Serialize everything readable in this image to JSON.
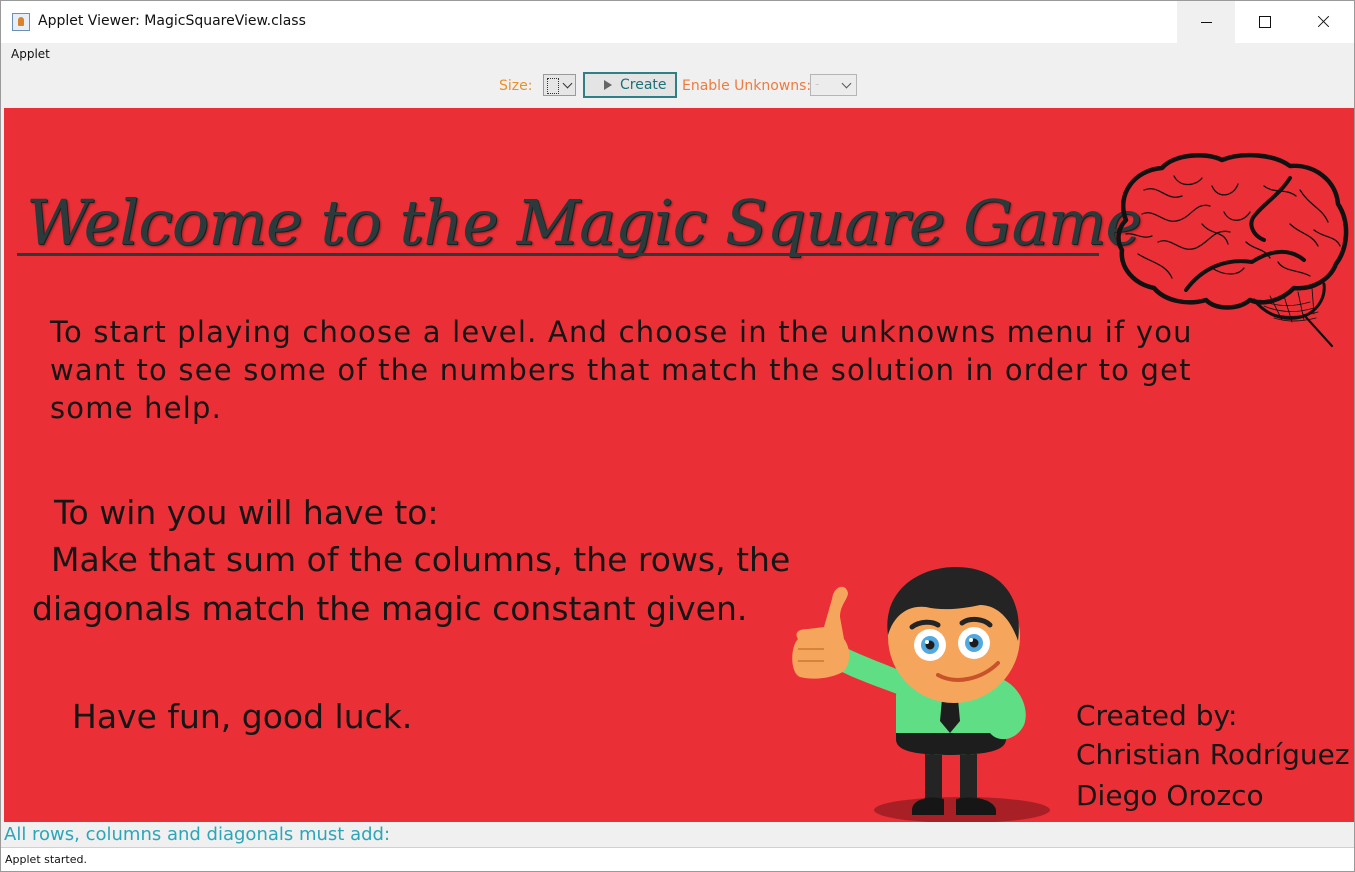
{
  "window": {
    "title": "Applet Viewer: MagicSquareView.class"
  },
  "menu": {
    "items": [
      "Applet"
    ]
  },
  "toolbar": {
    "size_label": "Size:",
    "size_value": "",
    "create_label": "Create",
    "unknowns_label": "Enable Unknowns:",
    "unknowns_value": "-"
  },
  "content": {
    "welcome_title": "Welcome to the Magic Square Game",
    "instructions": "To start playing choose a level. And choose in the unknowns menu if you want to see some of the numbers that match the solution in order to get some help.",
    "win_heading": "To win you will have to:",
    "win_line1": "Make that sum of the columns, the rows, the",
    "win_line2": "diagonals match the magic constant given.",
    "have_fun": "Have fun, good luck.",
    "credits_label": "Created by:",
    "credits": [
      "Christian Rodríguez",
      "Diego Orozco"
    ]
  },
  "status": {
    "magic_constant_label": "All rows, columns and diagonals must add:",
    "applet_status": "Applet started."
  },
  "colors": {
    "canvas_background": "#eb2f36",
    "size_label": "#e9902a",
    "unknowns_label": "#ee7b3e",
    "create_text": "#1e7077",
    "magic_text": "#2ba6b8"
  }
}
